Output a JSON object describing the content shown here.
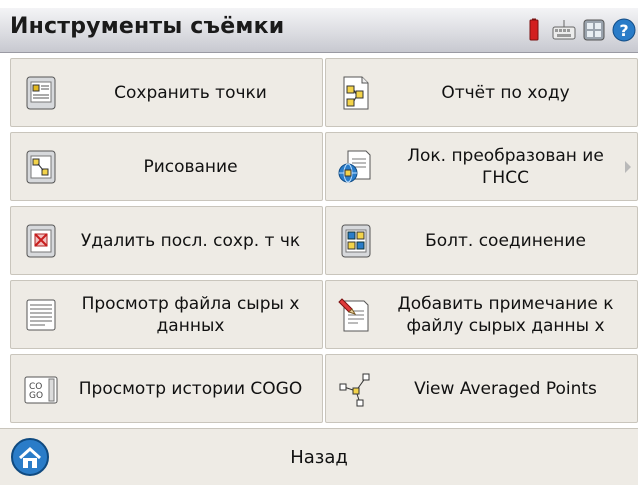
{
  "header": {
    "title": "Инструменты съёмки"
  },
  "tiles": [
    {
      "label": "Сохранить точки",
      "icon": "save-points-icon"
    },
    {
      "label": "Отчёт по ходу",
      "icon": "traverse-report-icon"
    },
    {
      "label": "Рисование",
      "icon": "drawing-icon"
    },
    {
      "label": "Лок. преобразован ие ГНСС",
      "icon": "gnss-local-transform-icon",
      "has_submenu": true
    },
    {
      "label": "Удалить посл. сохр. т чк",
      "icon": "delete-last-point-icon"
    },
    {
      "label": "Болт. соединение",
      "icon": "bolt-connection-icon"
    },
    {
      "label": "Просмотр файла сыры х данных",
      "icon": "raw-data-view-icon"
    },
    {
      "label": "Добавить примечание к файлу сырых данны х",
      "icon": "add-note-icon"
    },
    {
      "label": "Просмотр истории COGO",
      "icon": "cogo-history-icon"
    },
    {
      "label": "View Averaged Points",
      "icon": "averaged-points-icon"
    }
  ],
  "footer": {
    "back_label": "Назад",
    "icon": "home-icon"
  },
  "status_icons": [
    "battery-icon",
    "keyboard-icon",
    "settings-icon",
    "help-icon"
  ],
  "colors": {
    "tile_bg": "#eeebe5",
    "tile_border": "#c9c5bc",
    "accent_blue": "#2a7cc8",
    "battery_red": "#d21f1f"
  }
}
